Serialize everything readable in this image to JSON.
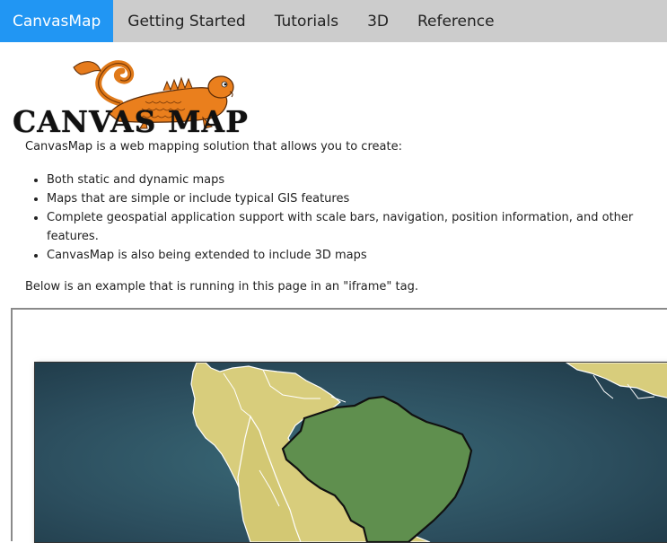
{
  "nav": {
    "items": [
      {
        "label": "CanvasMap",
        "active": true
      },
      {
        "label": "Getting Started",
        "active": false
      },
      {
        "label": "Tutorials",
        "active": false
      },
      {
        "label": "3D",
        "active": false
      },
      {
        "label": "Reference",
        "active": false
      }
    ]
  },
  "logo": {
    "text": "CANVAS MAP"
  },
  "content": {
    "intro": "CanvasMap is a web mapping solution that allows you to create:",
    "features": [
      "Both static and dynamic maps",
      "Maps that are simple or include typical GIS features",
      "Complete geospatial application support with scale bars, navigation, position information, and other features.",
      "CanvasMap is also being extended to include 3D maps"
    ],
    "outro": "Below is an example that is running in this page in an \"iframe\" tag."
  },
  "colors": {
    "nav_bg": "#cccccc",
    "nav_active": "#2196F3",
    "ocean": "#2e4d5c",
    "land": "#d7cd7b",
    "highlight": "#5f8f4e"
  }
}
